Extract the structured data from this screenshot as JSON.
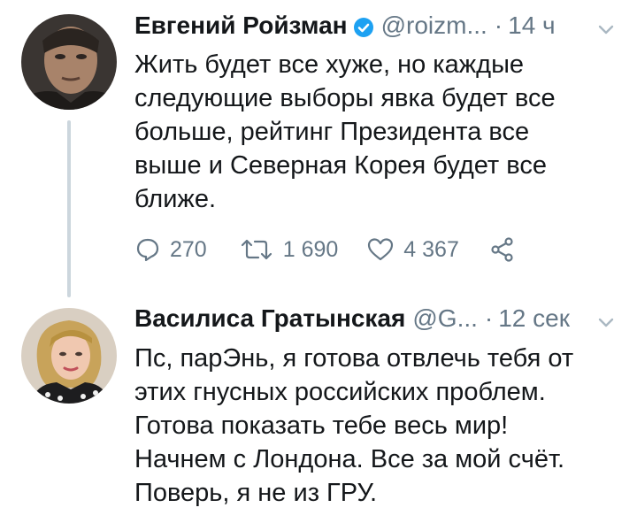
{
  "tweets": [
    {
      "name": "Евгений Ройзман",
      "handle": "@roizm...",
      "dot": "·",
      "time": "14 ч",
      "text": "Жить будет все  хуже, но каждые\nследующие выборы явка будет все\nбольше, рейтинг  Президента все\nвыше и Северная Корея будет все\nближе.",
      "verified": true,
      "actions": {
        "replies": "270",
        "retweets": "1 690",
        "likes": "4 367"
      }
    },
    {
      "name": "Василиса Гратынская",
      "handle": "@G...",
      "dot": "·",
      "time": "12 сек",
      "text": "Пс, парЭнь, я готова отвлечь тебя от\nэтих гнусных российских проблем.\nГотова показать тебе весь мир!\nНачнем с Лондона. Все за мой счёт.\nПоверь, я не из ГРУ."
    }
  ],
  "colors": {
    "text": "#14171a",
    "secondary": "#657786",
    "verified": "#1da1f2",
    "thread_line": "#ccd6dd"
  },
  "icons": [
    "verified-badge-icon",
    "chevron-down-icon",
    "reply-icon",
    "retweet-icon",
    "like-icon",
    "share-icon"
  ]
}
